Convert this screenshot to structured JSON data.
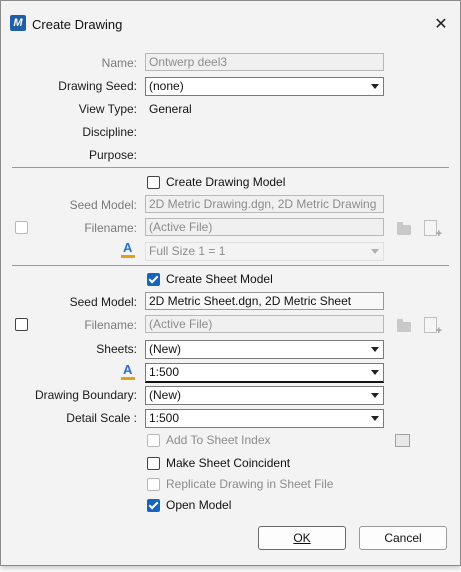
{
  "window": {
    "title": "Create Drawing",
    "close_glyph": "✕",
    "app_icon_glyph": "M"
  },
  "labels": {
    "name": "Name:",
    "drawing_seed": "Drawing Seed:",
    "view_type": "View Type:",
    "discipline": "Discipline:",
    "purpose": "Purpose:",
    "seed_model": "Seed Model:",
    "filename": "Filename:",
    "sheets": "Sheets:",
    "drawing_boundary": "Drawing Boundary:",
    "detail_scale": "Detail Scale :"
  },
  "values": {
    "name": "Ontwerp deel3",
    "drawing_seed": "(none)",
    "view_type": "General"
  },
  "drawing_model": {
    "create_label": "Create Drawing Model",
    "checked": false,
    "seed_model": "2D Metric Drawing.dgn, 2D Metric Drawing",
    "filename": "(Active File)",
    "annotation_scale": "Full Size 1 = 1"
  },
  "sheet_model": {
    "create_label": "Create Sheet Model",
    "checked": true,
    "seed_model": "2D Metric Sheet.dgn, 2D Metric Sheet",
    "filename": "(Active File)",
    "sheets": "(New)",
    "annotation_scale": "1:500",
    "drawing_boundary": "(New)",
    "detail_scale": "1:500"
  },
  "options": {
    "add_to_sheet_index": "Add To Sheet Index",
    "make_sheet_coincident": "Make Sheet Coincident",
    "replicate_drawing": "Replicate Drawing in Sheet File",
    "open_model": "Open Model"
  },
  "buttons": {
    "ok": "OK",
    "cancel": "Cancel"
  },
  "colors": {
    "accent": "#1565c0",
    "dialog_bg": "#f3f3f3",
    "icon_blue": "#1f5fa8"
  }
}
